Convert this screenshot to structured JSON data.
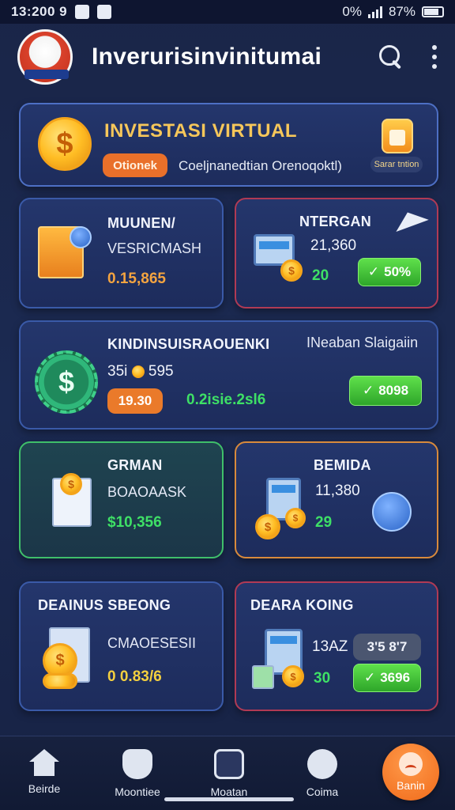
{
  "status_bar": {
    "time": "13:200 9",
    "network": "0%",
    "battery": "87%"
  },
  "header": {
    "title": "Inverurisinvinitumai"
  },
  "hero": {
    "title": "INVESTASI VIRTUAL",
    "badge_pill": "Otionek",
    "subtitle": "Coeljnanedtian Orenoqoktl)",
    "side_label": "Sarar tntion"
  },
  "cards": {
    "c1": {
      "title": "MUUNEN/",
      "subtitle": "VESRICMASH",
      "value": "0.15,865"
    },
    "c2": {
      "title": "NTERGAN",
      "value": "21,360",
      "delta": "20",
      "button": "50%"
    },
    "c3": {
      "title": "KINDINSUISRAOUENKI",
      "right_title": "INeaban Slaigaiin",
      "value": "35i",
      "value2": "595",
      "pill": "19.30",
      "green_text": "0.2isie.2sl6",
      "button": "8098"
    },
    "c4": {
      "title": "GRMAN",
      "subtitle": "BOAOAASK",
      "value": "$10,356"
    },
    "c5": {
      "title": "BEMIDA",
      "value": "11,380",
      "delta": "29"
    },
    "c6": {
      "title": "DEAINUS SBEONG",
      "subtitle": "CMAOESESII",
      "value": "0 0.83/6"
    },
    "c7": {
      "title": "DEARA KOING",
      "value": "13AZ",
      "delta": "30",
      "gray_pill": "3'5 8'7",
      "button": "3696"
    }
  },
  "nav": {
    "items": [
      {
        "label": "Beirde",
        "icon": "home-icon"
      },
      {
        "label": "Moontiee",
        "icon": "shield-icon"
      },
      {
        "label": "Moatan",
        "icon": "document-icon"
      },
      {
        "label": "Coima",
        "icon": "user-icon"
      },
      {
        "label": "Banin",
        "icon": "profile-icon"
      }
    ]
  },
  "colors": {
    "background": "#1a2548",
    "accent_gold": "#f6c75a",
    "accent_green": "#3ee066",
    "accent_orange": "#e9702a"
  }
}
